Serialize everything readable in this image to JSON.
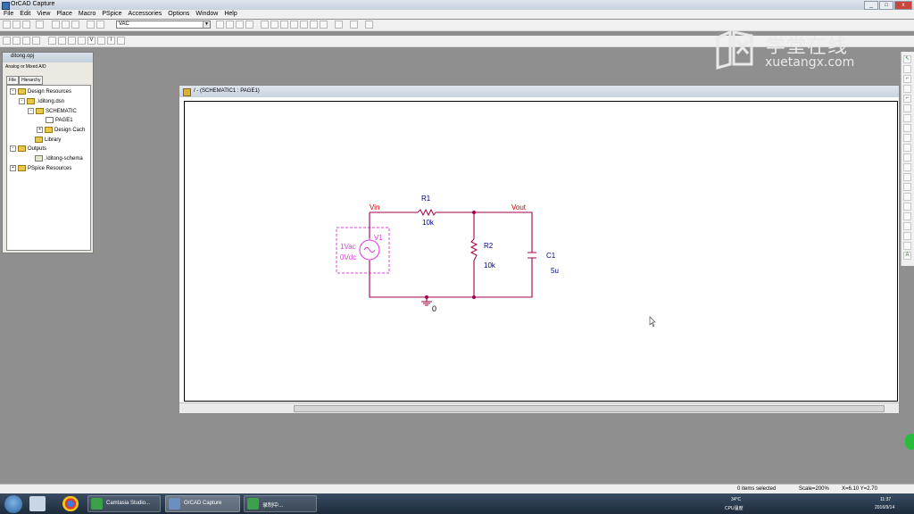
{
  "window": {
    "title": "OrCAD Capture",
    "controls": [
      "_",
      "□",
      "x"
    ]
  },
  "menu": [
    "File",
    "Edit",
    "View",
    "Place",
    "Macro",
    "PSpice",
    "Accessories",
    "Options",
    "Window",
    "Help"
  ],
  "toolbar": {
    "part_combo": "VAC"
  },
  "watermark": {
    "cn": "学堂在线",
    "en": "xuetangx.com"
  },
  "project": {
    "title": "ditong.opj",
    "subtitle": "Analog or Mixed A/D",
    "tabs": [
      "File",
      "Hierarchy"
    ],
    "tree": [
      {
        "label": "Design Resources"
      },
      {
        "label": ".\\ditong.dsn"
      },
      {
        "label": "SCHEMATIC"
      },
      {
        "label": "PAGE1"
      },
      {
        "label": "Design Cach"
      },
      {
        "label": "Library"
      },
      {
        "label": "Outputs"
      },
      {
        "label": ".\\ditong-schema"
      },
      {
        "label": "PSpice Resources"
      }
    ]
  },
  "schematic_window": {
    "title": "/ - (SCHEMATIC1 : PAGE1)"
  },
  "schematic": {
    "nets": {
      "in": "Vin",
      "out": "Vout",
      "ground": "0"
    },
    "source": {
      "name": "V1",
      "ac": "1Vac",
      "dc": "0Vdc"
    },
    "r1": {
      "name": "R1",
      "value": "10k"
    },
    "r2": {
      "name": "R2",
      "value": "10k"
    },
    "c1": {
      "name": "C1",
      "value": "5u"
    },
    "colors": {
      "wire": "#a0004a",
      "net_label": "#cc0000",
      "part_text": "#000080",
      "source": "#e040e0"
    }
  },
  "status": {
    "selection": "0 items selected",
    "scale": "Scale=200%",
    "coords": "X=6.10  Y=2.70"
  },
  "taskbar": {
    "tasks": [
      "Camtasia Studio...",
      "OrCAD Capture",
      "录制中..."
    ],
    "tray": {
      "temp": "34°C",
      "cpu": "CPU温度",
      "time": "11:37",
      "date": "2016/9/14"
    }
  }
}
